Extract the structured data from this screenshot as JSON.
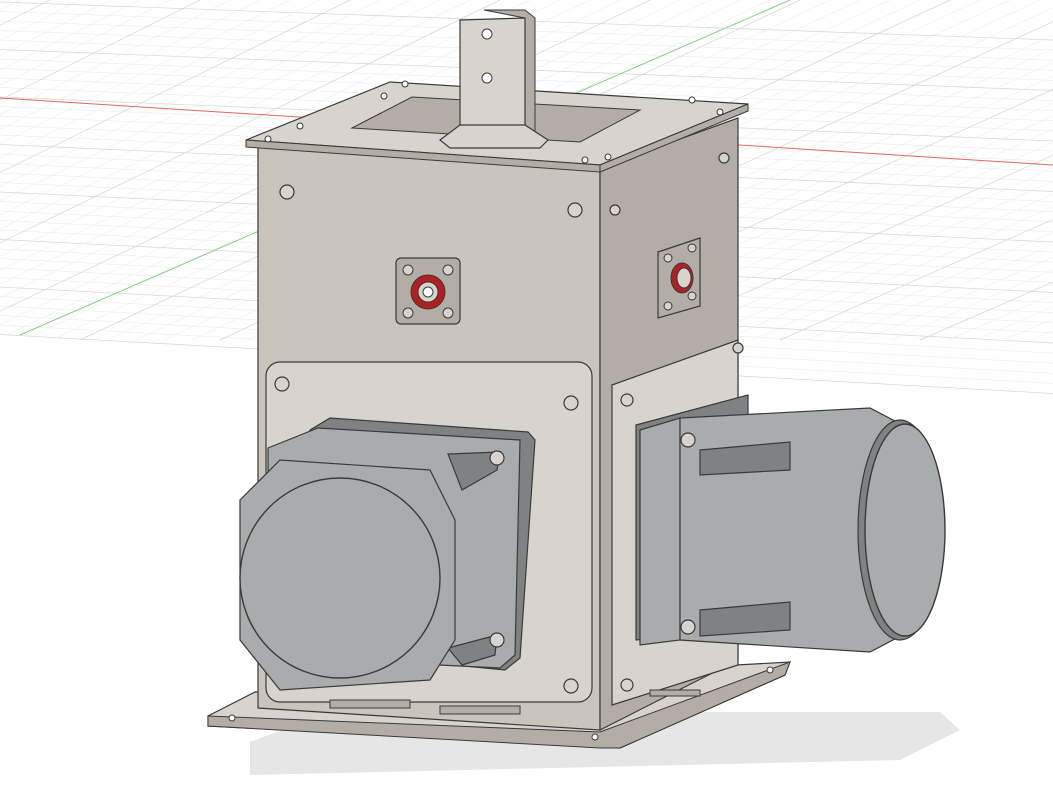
{
  "viewport": {
    "background": "#ffffff",
    "grid_color": "#d4d4d4",
    "grid_minor_color": "#e9e9e9",
    "x_axis_color": "#e06666",
    "y_axis_color": "#7fcf7f"
  },
  "model": {
    "body_color": "#c9c4bc",
    "body_shadow_color": "#b3ada5",
    "plate_color": "#d8d4cd",
    "motor_color": "#a9acac",
    "motor_dark_color": "#7f8282",
    "bearing_accent_color": "#b02020",
    "edge_color": "#3a3a3a",
    "shadow_color": "#e6e6e6"
  },
  "icons": [
    "grid-plane-icon",
    "stepper-motor-front-icon",
    "stepper-motor-side-icon",
    "flange-bearing-icon",
    "bracket-tab-icon"
  ]
}
